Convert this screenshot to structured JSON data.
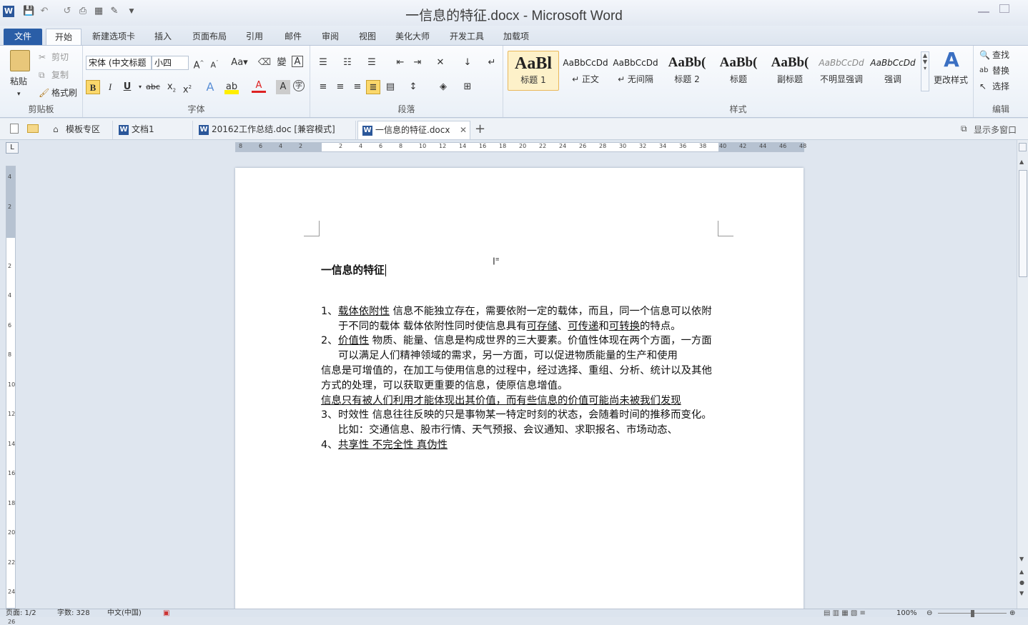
{
  "window": {
    "title": "一信息的特征.docx - Microsoft Word"
  },
  "ribbon_tabs": [
    "文件",
    "开始",
    "新建选项卡",
    "插入",
    "页面布局",
    "引用",
    "邮件",
    "审阅",
    "视图",
    "美化大师",
    "开发工具",
    "加载项"
  ],
  "clipboard": {
    "paste": "粘贴",
    "cut": "剪切",
    "copy": "复制",
    "format_painter": "格式刷",
    "group_label": "剪贴板"
  },
  "font": {
    "font_name": "宋体 (中文标题",
    "font_size": "小四",
    "group_label": "字体"
  },
  "paragraph": {
    "group_label": "段落"
  },
  "styles": {
    "items": [
      {
        "preview": "AaBl",
        "name": "标题 1"
      },
      {
        "preview": "AaBbCcDd",
        "name": "↵ 正文"
      },
      {
        "preview": "AaBbCcDd",
        "name": "↵ 无间隔"
      },
      {
        "preview": "AaBb(",
        "name": "标题 2"
      },
      {
        "preview": "AaBb(",
        "name": "标题"
      },
      {
        "preview": "AaBb(",
        "name": "副标题"
      },
      {
        "preview": "AaBbCcDd",
        "name": "不明显强调"
      },
      {
        "preview": "AaBbCcDd",
        "name": "强调"
      }
    ],
    "change_styles": "更改样式",
    "group_label": "样式"
  },
  "editing": {
    "find": "查找",
    "replace": "替换",
    "select": "选择",
    "group_label": "编辑"
  },
  "doc_tabs": [
    {
      "label": "模板专区"
    },
    {
      "label": "文档1"
    },
    {
      "label": "20162工作总结.doc [兼容模式]"
    },
    {
      "label": "一信息的特征.docx"
    }
  ],
  "show_multi_window": "显示多窗口",
  "ruler_h_labels": [
    "8",
    "6",
    "4",
    "2",
    "",
    "2",
    "4",
    "6",
    "8",
    "10",
    "12",
    "14",
    "16",
    "18",
    "20",
    "22",
    "24",
    "26",
    "28",
    "30",
    "32",
    "34",
    "36",
    "38",
    "40",
    "42",
    "44",
    "46",
    "48"
  ],
  "ruler_v_labels": [
    "4",
    "2",
    "",
    "2",
    "4",
    "6",
    "8",
    "10",
    "12",
    "14",
    "16",
    "18",
    "20",
    "22",
    "24",
    "26"
  ],
  "document": {
    "heading": "一信息的特征",
    "items": [
      {
        "num": "1、",
        "parts": [
          {
            "t": "载体依附性",
            "u": true
          },
          {
            "t": "  信息不能独立存在，需要依附一定的载体，而且，同一个信息可以依附于不同的载体  载体依附性同时使信息具有",
            "u": false
          },
          {
            "t": "可存储",
            "u": true
          },
          {
            "t": "、",
            "u": false
          },
          {
            "t": "可传递",
            "u": true
          },
          {
            "t": "和",
            "u": false
          },
          {
            "t": "可转换",
            "u": true
          },
          {
            "t": "的特点。",
            "u": false
          }
        ]
      },
      {
        "num": "2、",
        "parts": [
          {
            "t": "价值性",
            "u": true
          },
          {
            "t": "    物质、能量、信息是构成世界的三大要素。价值性体现在两个方面，一方面可以满足人们精神领域的需求，另一方面，可以促进物质能量的生产和使用",
            "u": false
          }
        ]
      }
    ],
    "para1": "信息是可增值的，在加工与使用信息的过程中，经过选择、重组、分析、统计以及其他方式的处理，可以获取更重要的信息，使原信息增值。",
    "para2": "信息只有被人们利用才能体现出其价值，而有些信息的价值可能尚未被我们发现",
    "items2": [
      {
        "num": "3、",
        "parts": [
          {
            "t": "时效性  信息往往反映的只是事物某一特定时刻的状态，会随着时间的推移而变化。比如：交通信息、股市行情、天气预报、会议通知、求职报名、市场动态、",
            "u": false
          }
        ]
      },
      {
        "num": "4、",
        "parts": [
          {
            "t": "共享性  不完全性  真伪性",
            "u": true
          }
        ]
      }
    ]
  },
  "status": {
    "page": "页面: 1/2",
    "words": "字数: 328",
    "language": "中文(中国)",
    "zoom": "100%"
  }
}
